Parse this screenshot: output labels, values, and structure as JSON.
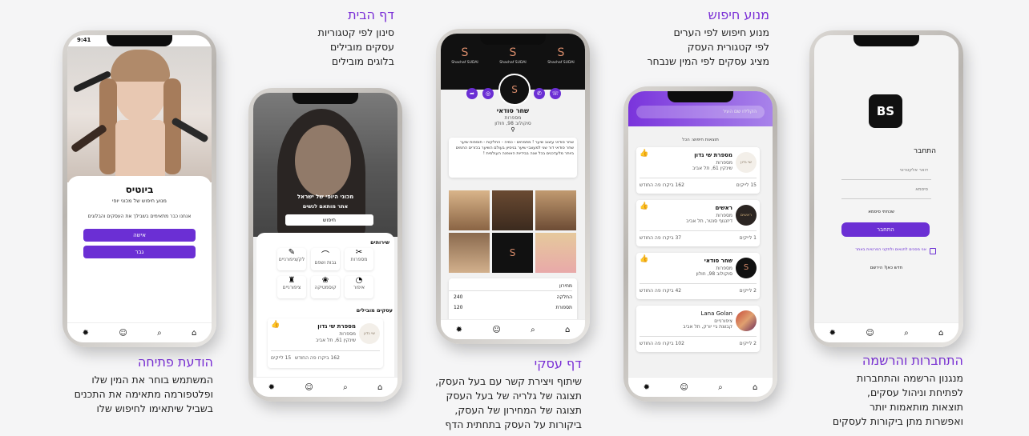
{
  "captions": {
    "search": {
      "title": "מנוע חיפוש",
      "lines": [
        "מנוע חיפוש לפי הערים",
        "לפי קטגורית העסק",
        "מציג עסקים לפי המין שנבחר"
      ]
    },
    "home": {
      "title": "דף הבית",
      "lines": [
        "סינון לפי קטגוריות",
        "עסקים מובילים",
        "בלוגים מובילים"
      ]
    },
    "opening": {
      "title": "הודעת פתיחה",
      "lines": [
        "המשתמש בוחר את המין שלו",
        "ופלטפורמה מתאימה את התכנים",
        "בשביל שיתאימו לחיפוש שלו"
      ]
    },
    "business": {
      "title": "דף עסקי",
      "lines": [
        "שיתוף ויצירת קשר עם בעל העסק,",
        "תצוגה של גלריה של בעל העסק",
        "תצוגה של המחירון של העסק,",
        "ביקורות על העסק בתחתית הדף"
      ]
    },
    "login": {
      "title": "התחברות והרשמה",
      "lines": [
        "מנגנון הרשמה והתחברות",
        "לפתיחת וניהול עסקים,",
        "תוצאות מותאמות יותר",
        "ואפשרות מתן ביקורות לעסקים"
      ]
    }
  },
  "colors": {
    "accent": "#6b2fd4",
    "caption_title": "#7a2fd6"
  },
  "tabbar_icons": [
    "bug-icon",
    "user-icon",
    "search-icon",
    "home-icon"
  ],
  "phone1": {
    "time": "9:41",
    "title": "ביוטיס",
    "subtitle": "מנוע חיפוש של מכוני יופי",
    "intro": "אנחנו כבר מתאימים בשבילך את העסקים והבלוגים",
    "btn_woman": "אישה",
    "btn_man": "גבר"
  },
  "phone2": {
    "hero_line1": "מכוני היופי של ישראל",
    "hero_line2": "אתר מותאם לנשים",
    "search_btn": "חיפוש",
    "services_title": "שירותים",
    "services": [
      "מספרות",
      "גבות ושפם",
      "לק/ציפורניים",
      "איפור",
      "קוסמטיקה",
      "ציפורניים"
    ],
    "top_title": "עסקים מובילים",
    "biz": {
      "name": "מספרת שי גדון",
      "cat": "מספרות",
      "addr": "שינקין 61, תל אביב",
      "likes": "15 לייקים",
      "visits": "162 ביקרו פה החודש"
    }
  },
  "phone3": {
    "brand": "Shachaf SUDAI",
    "name": "שחר סודאי",
    "cat": "מספרות",
    "addr": "סוקולוב 98, חולון",
    "about": "שחר סודאי עיצוב שיער ! מתמחים - כמיה - החלקות - תוספות שיער שחר סודאי דור שני למעצבי שיער בניסיון בעולם השיער בכזרים החמים ביותר מלעדכנים בכל שנה בבידיות האופנה העולמית !",
    "price_title": "מחירון",
    "prices": [
      {
        "label": "החלקה",
        "value": "240"
      },
      {
        "label": "תספורת",
        "value": "120"
      }
    ]
  },
  "phone4": {
    "search_placeholder": "הקלידו שם העיר",
    "results_label": "תוצאות חיפוש: הכל",
    "results": [
      {
        "name": "מספרת שי גדון",
        "cat": "מספרות",
        "addr": "שינקין 61, תל אביב",
        "likes": "15 לייקים",
        "visits": "162 ביקרו פה החודש",
        "logo": "שי גדון"
      },
      {
        "name": "ראשים",
        "cat": "מספרות",
        "addr": "דיזנגוף סנטר, תל אביב",
        "likes": "1 לייקים",
        "visits": "37 ביקרו פה החודש",
        "logo": "ראשים"
      },
      {
        "name": "שחר סודאי",
        "cat": "מספרות",
        "addr": "סוקולוב 98, חולון",
        "likes": "2 לייקים",
        "visits": "42 ביקרו פה החודש",
        "logo": "S"
      },
      {
        "name": "Lana Golan",
        "cat": "ציפורניים",
        "addr": "קבוצת גיי יורק, תל אביב",
        "likes": "2 לייקים",
        "visits": "102 ביקרו פה החודש",
        "logo": ""
      }
    ]
  },
  "phone5": {
    "logo": "BS",
    "title": "התחבר",
    "email_ph": "דואר אלקטרוני",
    "password_ph": "סיסמא",
    "forgot": "שכחתי סיסמא",
    "login_btn": "התחבר",
    "terms": "אני מסכים לתנאים ולתקני הפרטיות באתר",
    "register": "חדש כאן? הירשם"
  }
}
